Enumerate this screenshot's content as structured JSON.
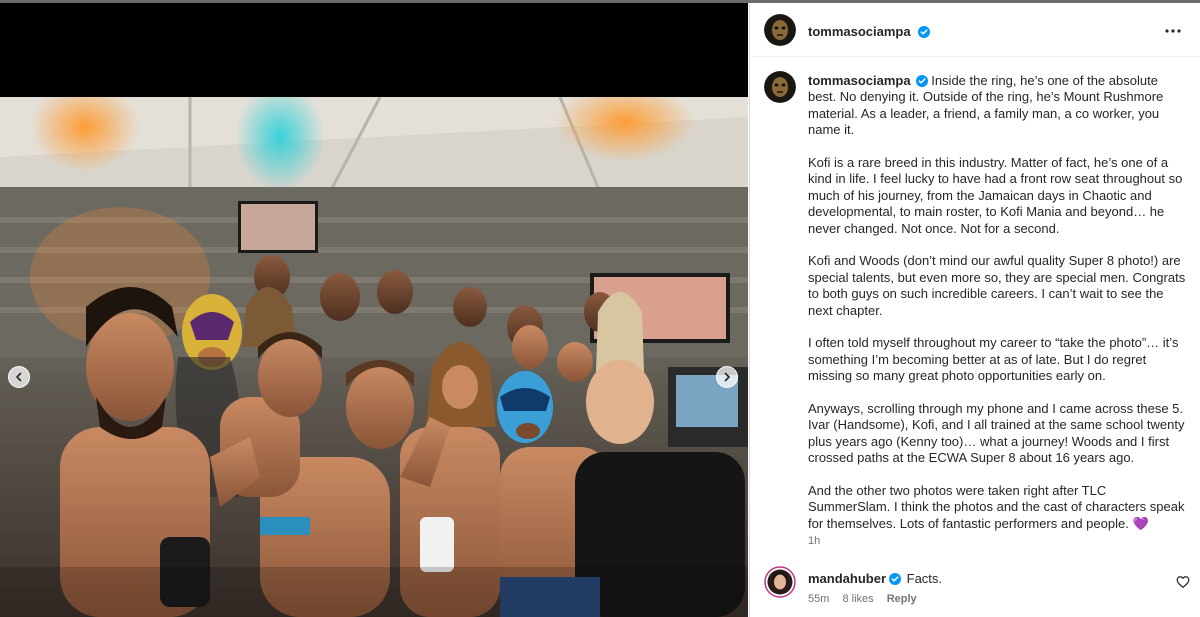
{
  "post": {
    "author": "tommasociampa",
    "caption_paragraphs": [
      "Inside the ring, he’s one of the absolute best. No denying it. Outside of the ring, he’s Mount Rushmore material. As a leader, a friend, a family man, a co worker, you name it.",
      "Kofi is a rare breed in this industry. Matter of fact, he’s one of a kind in life. I feel lucky to have had a front row seat throughout so much of his journey, from the Jamaican days in Chaotic and developmental, to main roster, to Kofi Mania and beyond… he never changed. Not once. Not for a second.",
      "Kofi and Woods (don’t mind our awful quality Super 8 photo!) are special talents, but even more so, they are special men. Congrats to both guys on such incredible careers. I can’t wait to see the next chapter.",
      "I often told myself throughout my career to “take the photo”… it’s something I’m becoming better at as of late. But I do regret missing so many great photo opportunities early on.",
      "Anyways, scrolling through my phone and I came across these 5. Ivar (Handsome), Kofi, and I all trained at the same school twenty plus years ago (Kenny too)… what a journey! Woods and I first crossed paths at the ECWA Super 8 about 16 years ago.",
      "And the other two photos were taken right after TLC SummerSlam. I think the photos and the cast of characters speak for themselves. Lots of fantastic performers and people. 💜"
    ],
    "caption_time": "1h"
  },
  "comment": {
    "author": "mandahuber",
    "text": "Facts.",
    "time": "55m",
    "likes": "8 likes",
    "reply_label": "Reply"
  },
  "icons": {
    "verified": "verified-badge-icon",
    "more": "more-options-icon",
    "prev": "chevron-left-icon",
    "next": "chevron-right-icon",
    "like": "heart-icon"
  },
  "colors": {
    "verified": "#0095f6",
    "text": "#262626",
    "secondary": "#737373",
    "border": "#dbdbdb"
  }
}
